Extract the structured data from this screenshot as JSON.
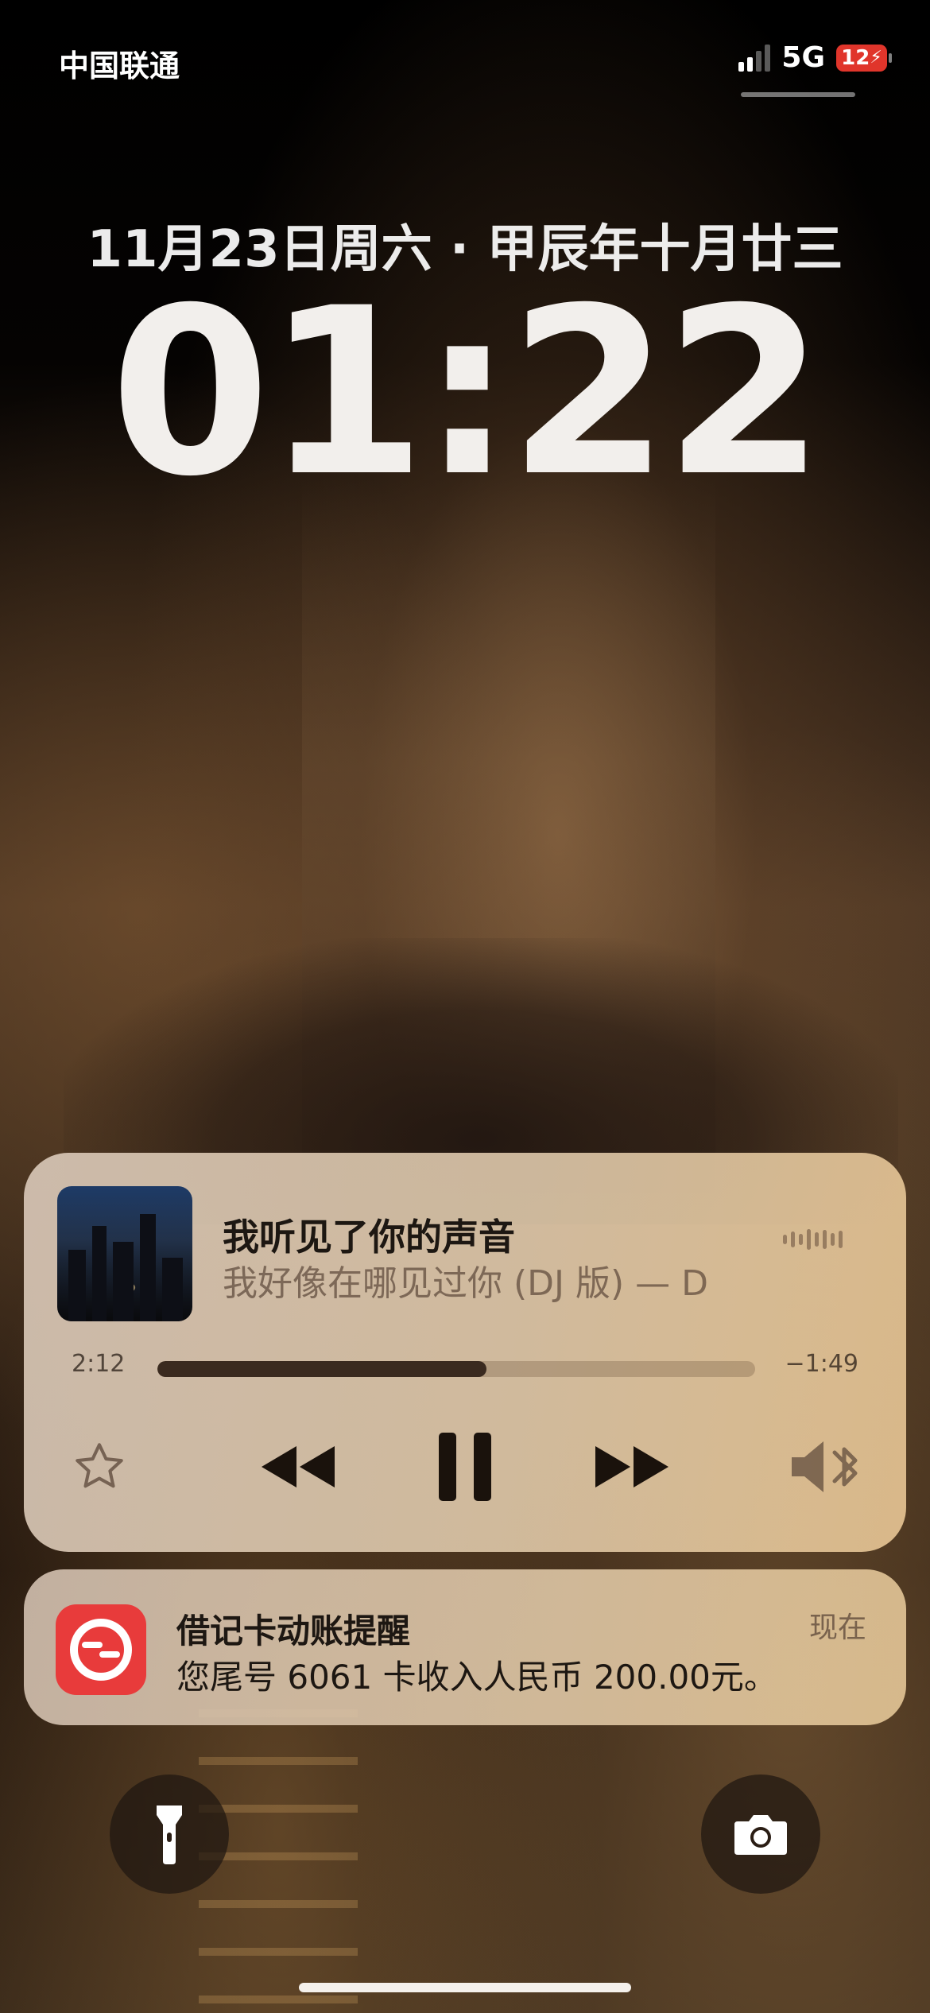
{
  "status_bar": {
    "carrier": "中国联通",
    "network": "5G",
    "battery": "12"
  },
  "lock_screen": {
    "date": "11月23日周六 · 甲辰年十月廿三",
    "time": "01:22"
  },
  "now_playing": {
    "title": "我听见了你的声音",
    "subtitle": "我好像在哪见过你 (DJ 版) — D",
    "elapsed": "2:12",
    "remaining": "−1:49",
    "progress": 0.55,
    "controls": [
      "star-icon",
      "rewind-icon",
      "pause-icon",
      "fast-forward-icon",
      "bluetooth-speaker-icon"
    ]
  },
  "notification": {
    "app_icon": "bank-app-icon",
    "title": "借记卡动账提醒",
    "body": "您尾号 6061 卡收入人民币 200.00元。",
    "time": "现在",
    "accent": "#e83b3b"
  },
  "quick_actions": {
    "left": "flashlight-icon",
    "right": "camera-icon"
  }
}
